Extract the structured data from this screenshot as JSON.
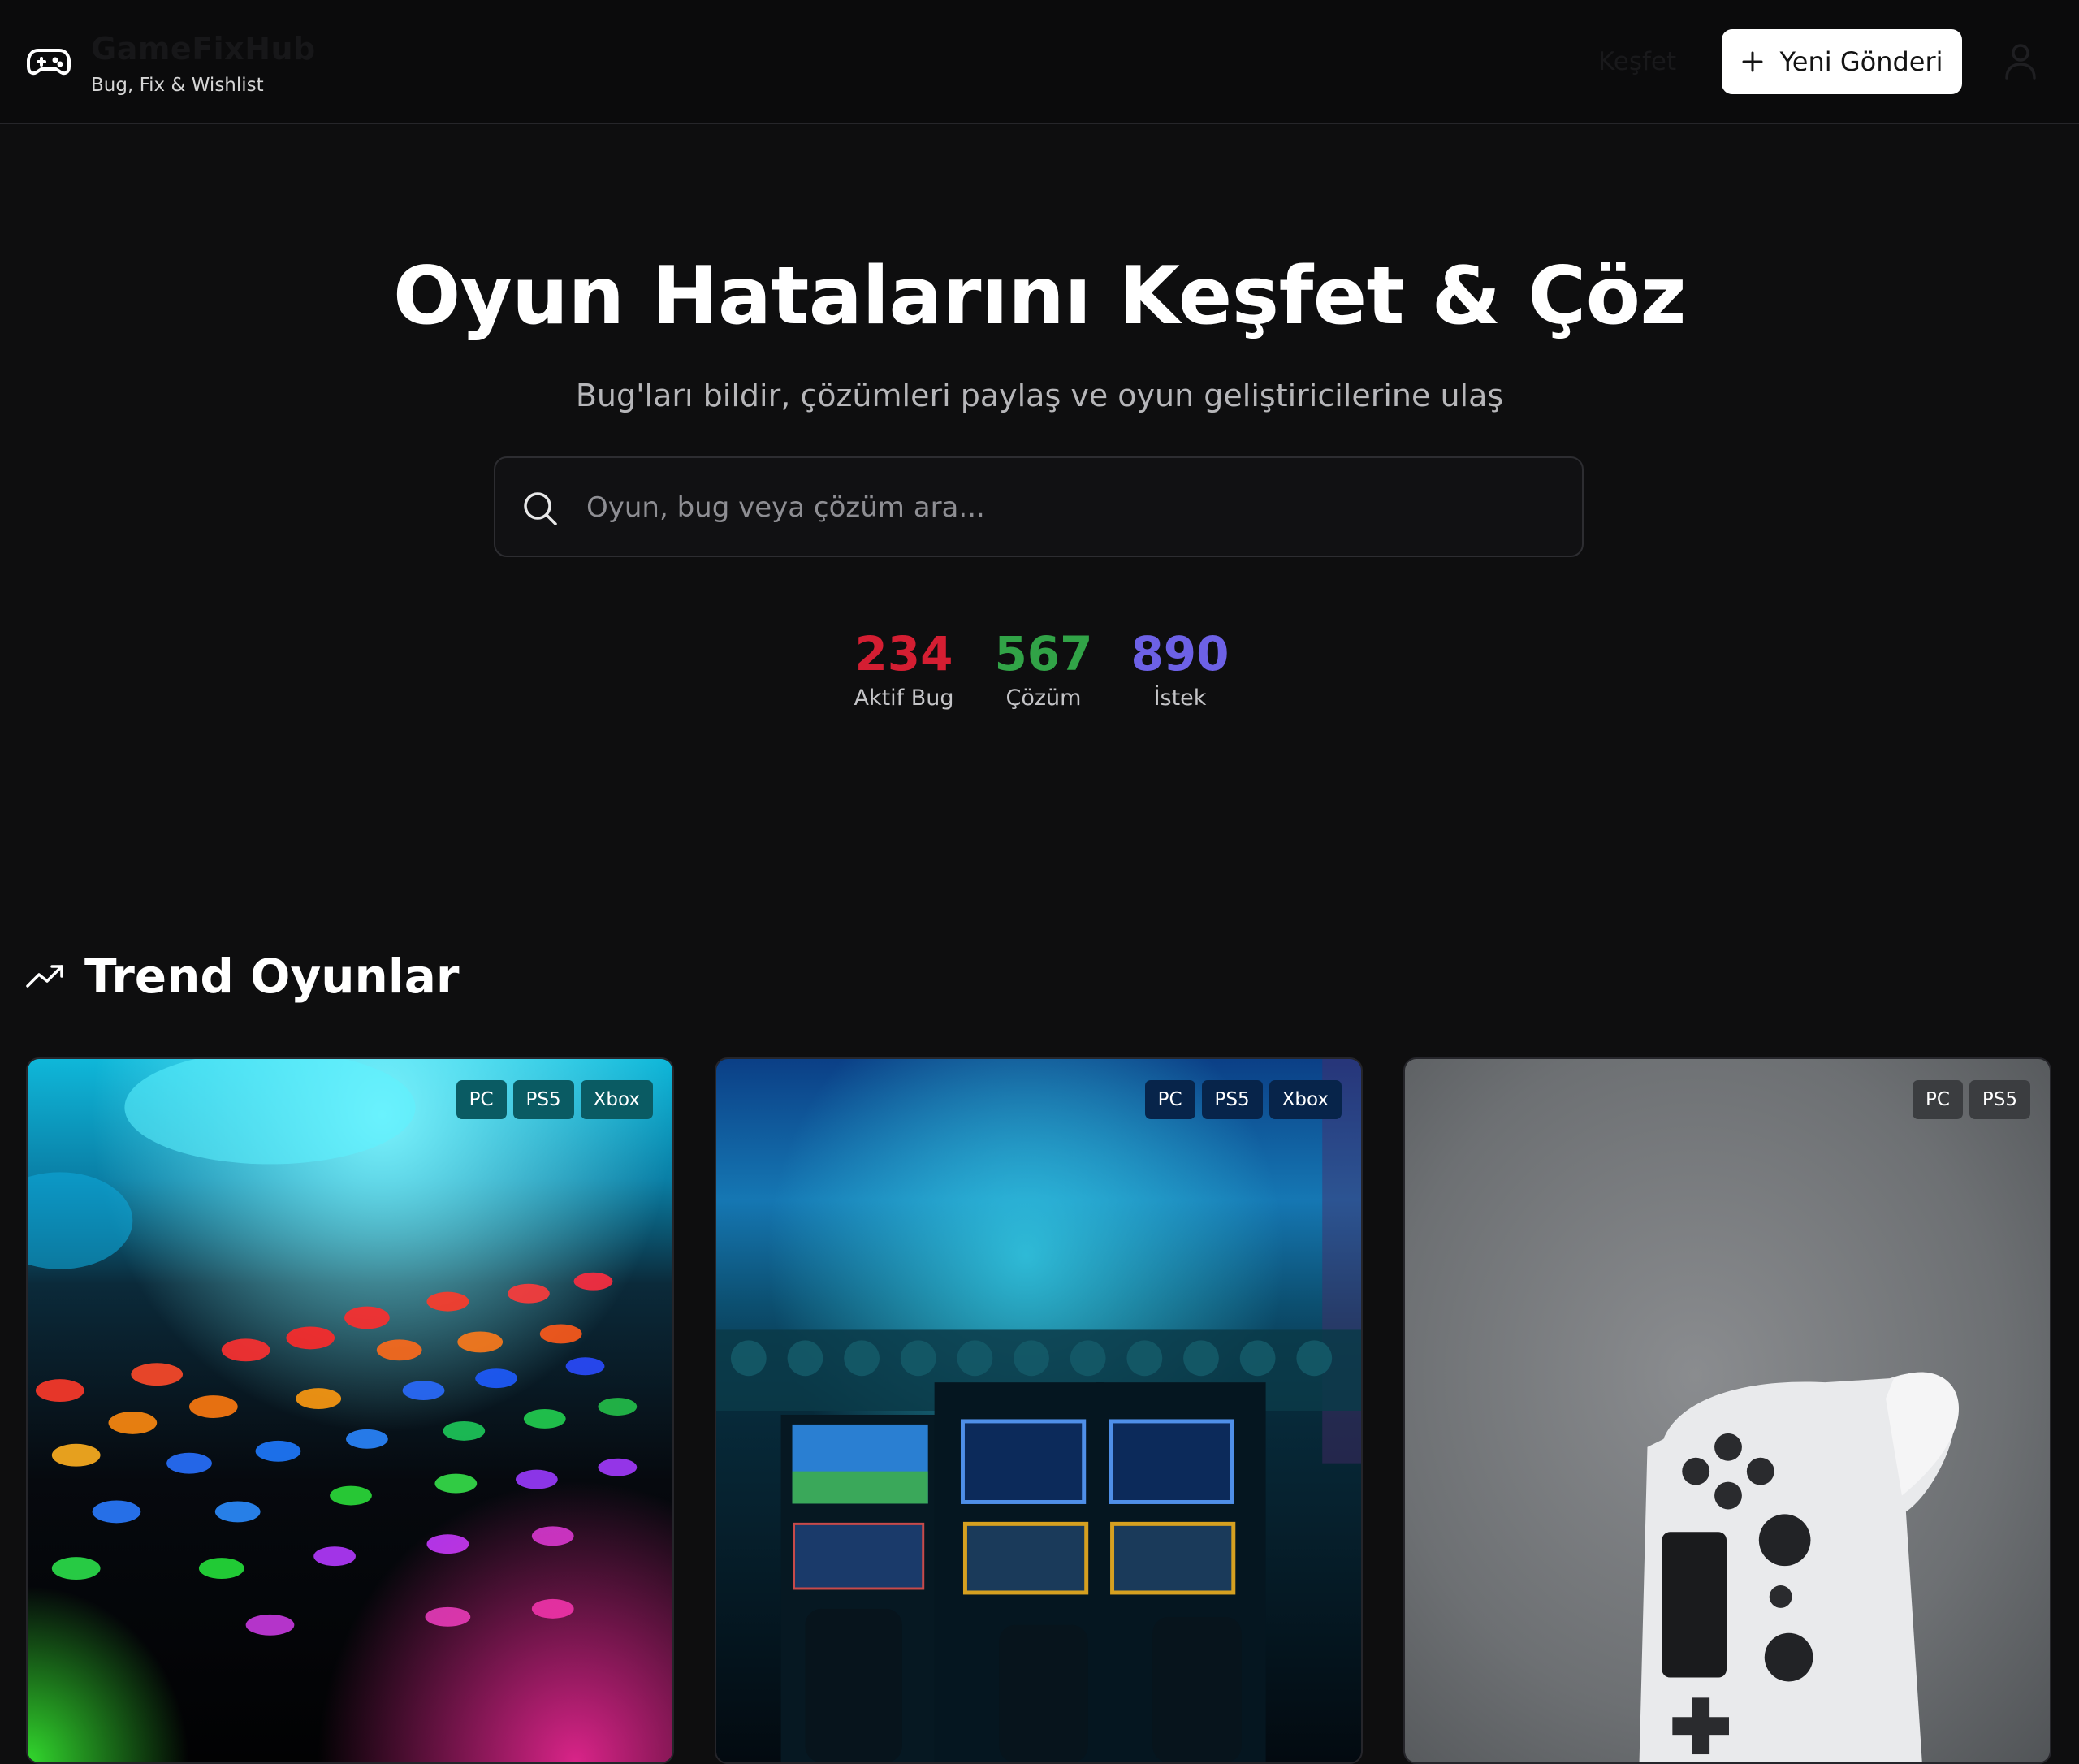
{
  "brand": {
    "name": "GameFixHub",
    "tagline": "Bug, Fix & Wishlist",
    "logo_icon": "gamepad-icon"
  },
  "nav": {
    "explore_label": "Keşfet",
    "new_post_label": "Yeni Gönderi",
    "new_post_icon": "plus-icon",
    "user_icon": "user-icon"
  },
  "hero": {
    "title": "Oyun Hatalarını Keşfet & Çöz",
    "subtitle": "Bug'ları bildir, çözümleri paylaş ve oyun geliştiricilerine ulaş",
    "search_placeholder": "Oyun, bug veya çözüm ara...",
    "search_icon": "search-icon"
  },
  "stats": [
    {
      "value": "234",
      "label": "Aktif Bug",
      "color": "#d41e32"
    },
    {
      "value": "567",
      "label": "Çözüm",
      "color": "#31a347"
    },
    {
      "value": "890",
      "label": "İstek",
      "color": "#6d61e6"
    }
  ],
  "trending": {
    "title": "Trend Oyunlar",
    "icon": "trending-up-icon",
    "cards": [
      {
        "tags": [
          "PC",
          "PS5",
          "Xbox"
        ]
      },
      {
        "tags": [
          "PC",
          "PS5",
          "Xbox"
        ]
      },
      {
        "tags": [
          "PC",
          "PS5"
        ]
      }
    ]
  }
}
